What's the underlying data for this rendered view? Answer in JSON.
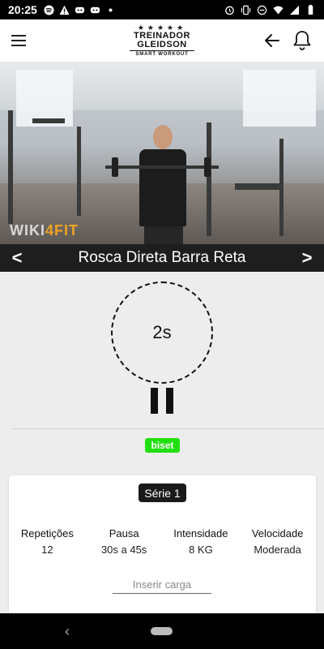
{
  "status_bar": {
    "time": "20:25",
    "left_icons": [
      "spotify-icon",
      "warning-icon",
      "discord-icon",
      "discord-icon",
      "dot-icon"
    ],
    "right_icons": [
      "alarm-icon",
      "vibrate-icon",
      "dnd-icon",
      "wifi-icon",
      "signal-icon",
      "battery-icon"
    ]
  },
  "header": {
    "logo": {
      "stars": "★★★★★",
      "line1": "TREINADOR",
      "line2": "GLEIDSON",
      "line3": "SMART WORKOUT"
    }
  },
  "video": {
    "watermark_main": "WIKI",
    "watermark_accent": "4FIT"
  },
  "exercise": {
    "name": "Rosca Direta Barra Reta",
    "prev_label": "<",
    "next_label": ">"
  },
  "timer": {
    "value": "2s"
  },
  "badge": {
    "label": "biset",
    "color": "#22e010"
  },
  "series": {
    "label": "Série 1",
    "stats": [
      {
        "label": "Repetições",
        "value": "12"
      },
      {
        "label": "Pausa",
        "value": "30s a 45s"
      },
      {
        "label": "Intensidade",
        "value": "8 KG"
      },
      {
        "label": "Velocidade",
        "value": "Moderada"
      }
    ],
    "load_placeholder": "Inserir carga"
  },
  "nav_bar": {
    "back_label": "‹"
  }
}
